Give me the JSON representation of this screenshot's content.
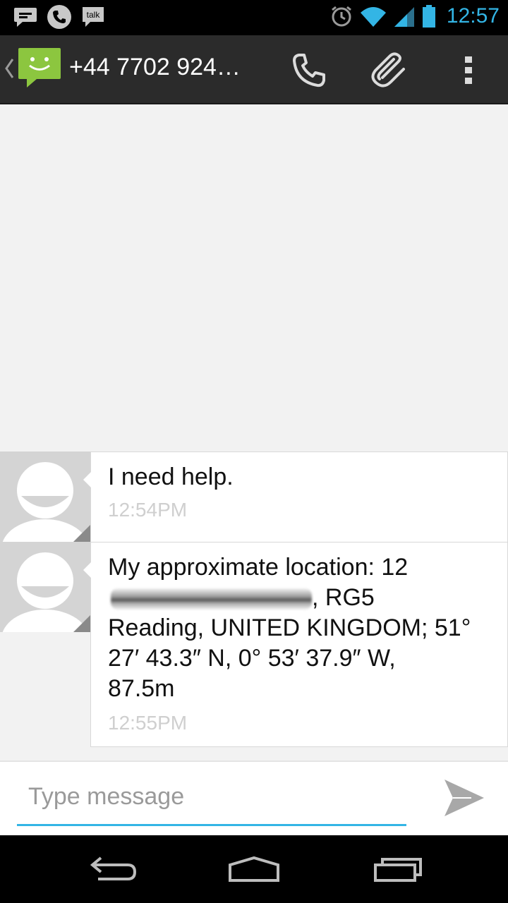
{
  "status_bar": {
    "time": "12:57",
    "notifications": [
      "message-icon",
      "phone-icon",
      "talk-icon"
    ],
    "talk_label": "talk",
    "system": [
      "alarm-icon",
      "wifi-icon",
      "signal-icon",
      "battery-icon"
    ],
    "accent": "#33b5e5"
  },
  "action_bar": {
    "title": "+44 7702 924…",
    "actions": [
      "call-icon",
      "attach-icon",
      "overflow-menu-icon"
    ],
    "app_icon_color": "#8cc63f"
  },
  "messages": [
    {
      "text": "I need help.",
      "time": "12:54PM"
    },
    {
      "line1": "My approximate location: 12",
      "line2_suffix": ", RG5",
      "line3": "Reading, UNITED KINGDOM; 51°",
      "line4": "27′ 43.3″ N, 0° 53′ 37.9″ W,",
      "line5": "87.5m",
      "time": "12:55PM"
    }
  ],
  "composer": {
    "placeholder": "Type message"
  },
  "nav_bar": [
    "back-icon",
    "home-icon",
    "recent-apps-icon"
  ]
}
